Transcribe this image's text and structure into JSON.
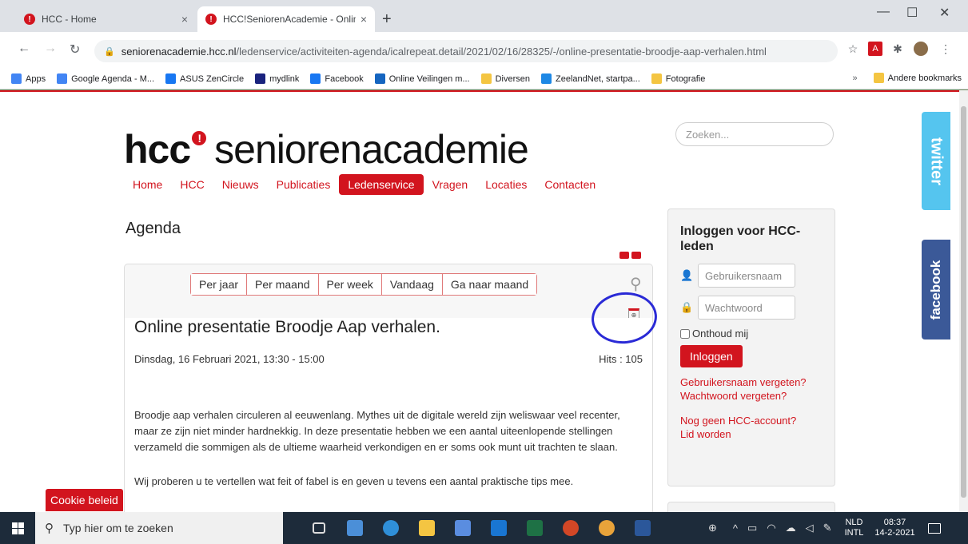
{
  "browser": {
    "tabs": [
      {
        "title": "HCC - Home",
        "close": "×"
      },
      {
        "title": "HCC!SeniorenAcademie - Online",
        "close": "×"
      }
    ],
    "new_tab": "+",
    "window_controls": {
      "minimize": "—",
      "maximize": "☐",
      "close": "✕"
    },
    "nav": {
      "back": "←",
      "forward": "→",
      "reload": "↻"
    },
    "url_host": "seniorenacademie.hcc.nl",
    "url_path": "/ledenservice/activiteiten-agenda/icalrepeat.detail/2021/02/16/28325/-/online-presentatie-broodje-aap-verhalen.html",
    "bookmarks": [
      {
        "label": "Apps",
        "color": "#4285f4"
      },
      {
        "label": "Google Agenda - M...",
        "color": "#4285f4"
      },
      {
        "label": "ASUS ZenCircle",
        "color": "#1877f2"
      },
      {
        "label": "mydlink",
        "color": "#1a237e"
      },
      {
        "label": "Facebook",
        "color": "#1877f2"
      },
      {
        "label": "Online Veilingen m...",
        "color": "#1565c0"
      },
      {
        "label": "Diversen",
        "color": "#f4c542"
      },
      {
        "label": "ZeelandNet, startpa...",
        "color": "#1e88e5"
      },
      {
        "label": "Fotografie",
        "color": "#f4c542"
      }
    ],
    "bookmarks_more": "»",
    "other_bookmarks": "Andere bookmarks"
  },
  "site": {
    "logo_brand": "hcc",
    "logo_dot": "!",
    "logo_name": "seniorenacademie",
    "search_placeholder": "Zoeken...",
    "nav": [
      "Home",
      "HCC",
      "Nieuws",
      "Publicaties",
      "Ledenservice",
      "Vragen",
      "Locaties",
      "Contacten"
    ],
    "active_nav": "Ledenservice",
    "section_title": "Agenda",
    "views": [
      "Per jaar",
      "Per maand",
      "Per week",
      "Vandaag",
      "Ga naar maand"
    ],
    "event": {
      "title": "Online presentatie Broodje Aap verhalen.",
      "date": "Dinsdag, 16 Februari 2021, 13:30 - 15:00",
      "hits": "Hits : 105",
      "paragraph1": "Broodje aap verhalen circuleren al eeuwenlang. Mythes uit de digitale wereld zijn weliswaar veel recenter, maar ze zijn niet minder hardnekkig. In deze presentatie hebben we een aantal uiteenlopende stellingen verzameld die sommigen als de ultieme waarheid verkondigen en er soms ook munt uit trachten te slaan.",
      "paragraph2": "Wij proberen u te vertellen wat feit of fabel is en geven u tevens een aantal praktische tips mee."
    },
    "login": {
      "title": "Inloggen voor HCC-leden",
      "username_placeholder": "Gebruikersnaam",
      "password_placeholder": "Wachtwoord",
      "remember": "Onthoud mij",
      "button": "Inloggen",
      "forgot_username": "Gebruikersnaam vergeten?",
      "forgot_password": "Wachtwoord vergeten?",
      "no_account": "Nog geen HCC-account?",
      "register": "Lid worden"
    },
    "social": {
      "twitter": "twitter",
      "facebook": "facebook"
    },
    "cookie": "Cookie beleid"
  },
  "taskbar": {
    "search_placeholder": "Typ hier om te zoeken",
    "lang_top": "NLD",
    "lang_bottom": "INTL",
    "time": "08:37",
    "date": "14-2-2021"
  }
}
